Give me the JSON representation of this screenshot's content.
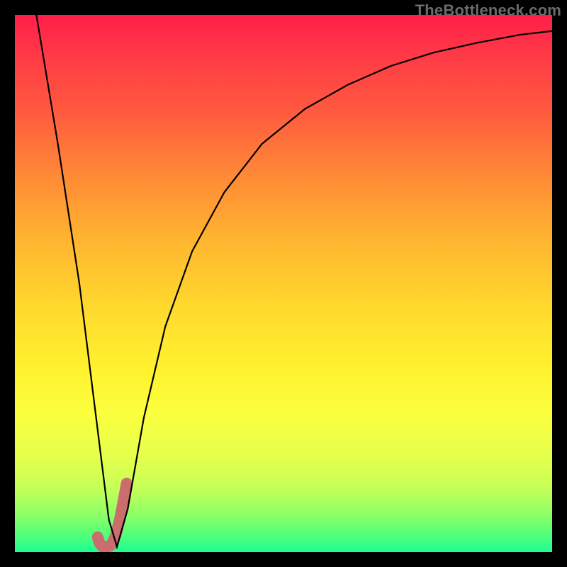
{
  "watermark": "TheBottleneck.com",
  "chart_data": {
    "type": "line",
    "title": "",
    "xlabel": "",
    "ylabel": "",
    "xlim": [
      0,
      100
    ],
    "ylim": [
      0,
      100
    ],
    "series": [
      {
        "name": "bottleneck-curve",
        "x": [
          4,
          8,
          12,
          14,
          16,
          17.5,
          19,
          21,
          24,
          28,
          33,
          39,
          46,
          54,
          62,
          70,
          78,
          86,
          94,
          100
        ],
        "y": [
          100,
          76,
          50,
          34,
          18,
          6,
          1,
          8,
          25,
          42,
          56,
          67,
          76,
          82.5,
          87,
          90.5,
          93,
          94.8,
          96.3,
          97
        ],
        "stroke": "#000000",
        "stroke_width": 2.2
      },
      {
        "name": "highlight-hook",
        "x": [
          15.4,
          15.8,
          16.4,
          17.2,
          18.0,
          18.8,
          19.6,
          20.8
        ],
        "y": [
          2.8,
          1.6,
          0.9,
          0.9,
          1.4,
          3.2,
          6.4,
          12.8
        ],
        "stroke": "#c96d6d",
        "stroke_width": 16,
        "linecap": "round"
      }
    ],
    "gradient_stops": [
      {
        "pos": 0,
        "color": "#ff1e49"
      },
      {
        "pos": 18,
        "color": "#ff5a3f"
      },
      {
        "pos": 42,
        "color": "#ffb530"
      },
      {
        "pos": 66,
        "color": "#fff22e"
      },
      {
        "pos": 88,
        "color": "#c6ff58"
      },
      {
        "pos": 100,
        "color": "#1dfe93"
      }
    ]
  }
}
